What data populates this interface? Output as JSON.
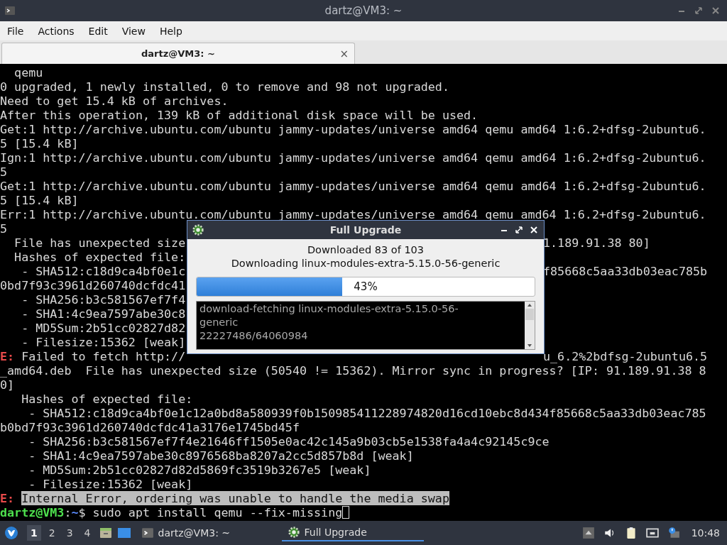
{
  "window": {
    "title": "dartz@VM3: ~",
    "menu": [
      "File",
      "Actions",
      "Edit",
      "View",
      "Help"
    ],
    "tabs": [
      {
        "label": "dartz@VM3: ~",
        "selected": true,
        "close": "×"
      }
    ],
    "terminal": {
      "lines": [
        {
          "segments": [
            {
              "kind": "text",
              "text": "  qemu"
            }
          ]
        },
        {
          "segments": [
            {
              "kind": "text",
              "text": "0 upgraded, 1 newly installed, 0 to remove and 98 not upgraded."
            }
          ]
        },
        {
          "segments": [
            {
              "kind": "text",
              "text": "Need to get 15.4 kB of archives."
            }
          ]
        },
        {
          "segments": [
            {
              "kind": "text",
              "text": "After this operation, 139 kB of additional disk space will be used."
            }
          ]
        },
        {
          "segments": [
            {
              "kind": "text",
              "text": "Get:1 http://archive.ubuntu.com/ubuntu jammy-updates/universe amd64 qemu amd64 1:6.2+dfsg-2ubuntu6."
            }
          ]
        },
        {
          "segments": [
            {
              "kind": "text",
              "text": "5 [15.4 kB]"
            }
          ]
        },
        {
          "segments": [
            {
              "kind": "text",
              "text": "Ign:1 http://archive.ubuntu.com/ubuntu jammy-updates/universe amd64 qemu amd64 1:6.2+dfsg-2ubuntu6."
            }
          ]
        },
        {
          "segments": [
            {
              "kind": "text",
              "text": "5"
            }
          ]
        },
        {
          "segments": [
            {
              "kind": "text",
              "text": "Get:1 http://archive.ubuntu.com/ubuntu jammy-updates/universe amd64 qemu amd64 1:6.2+dfsg-2ubuntu6."
            }
          ]
        },
        {
          "segments": [
            {
              "kind": "text",
              "text": "5 [15.4 kB]"
            }
          ]
        },
        {
          "segments": [
            {
              "kind": "text",
              "text": "Err:1 http://archive.ubuntu.com/ubuntu jammy-updates/universe amd64 qemu amd64 1:6.2+dfsg-2ubuntu6."
            }
          ]
        },
        {
          "segments": [
            {
              "kind": "text",
              "text": "5"
            }
          ]
        },
        {
          "segments": [
            {
              "kind": "text",
              "text": "  File has unexpected size"
            }
          ],
          "right": "1.189.91.38 80]"
        },
        {
          "segments": [
            {
              "kind": "text",
              "text": "  Hashes of expected file:"
            }
          ]
        },
        {
          "segments": [
            {
              "kind": "text",
              "text": "   - SHA512:c18d9ca4bf0e1c"
            }
          ],
          "right": "f85668c5aa33db03eac785b"
        },
        {
          "segments": [
            {
              "kind": "text",
              "text": "0bd7f93c3961d260740dcfdc41"
            }
          ]
        },
        {
          "segments": [
            {
              "kind": "text",
              "text": "   - SHA256:b3c581567ef7f4"
            }
          ]
        },
        {
          "segments": [
            {
              "kind": "text",
              "text": "   - SHA1:4c9ea7597abe30c8"
            }
          ]
        },
        {
          "segments": [
            {
              "kind": "text",
              "text": "   - MD5Sum:2b51cc02827d82"
            }
          ]
        },
        {
          "segments": [
            {
              "kind": "text",
              "text": "   - Filesize:15362 [weak]"
            }
          ]
        },
        {
          "segments": [
            {
              "kind": "error",
              "text": "E:"
            },
            {
              "kind": "text",
              "text": " Failed to fetch http://"
            }
          ],
          "right": "u_6.2%2bdfsg-2ubuntu6.5"
        },
        {
          "segments": [
            {
              "kind": "text",
              "text": "_amd64.deb  File has unexpected size (50540 != 15362). Mirror sync in progress? [IP: 91.189.91.38 8"
            }
          ]
        },
        {
          "segments": [
            {
              "kind": "text",
              "text": "0]"
            }
          ]
        },
        {
          "segments": [
            {
              "kind": "text",
              "text": "   Hashes of expected file:"
            }
          ]
        },
        {
          "segments": [
            {
              "kind": "text",
              "text": "    - SHA512:c18d9ca4bf0e1c12a0bd8a580939f0b150985411228974820d16cd10ebc8d434f85668c5aa33db03eac785"
            }
          ]
        },
        {
          "segments": [
            {
              "kind": "text",
              "text": "b0bd7f93c3961d260740dcfdc41a3176e1745bd45f"
            }
          ]
        },
        {
          "segments": [
            {
              "kind": "text",
              "text": "    - SHA256:b3c581567ef7f4e21646ff1505e0ac42c145a9b03cb5e1538fa4a4c92145c9ce"
            }
          ]
        },
        {
          "segments": [
            {
              "kind": "text",
              "text": "    - SHA1:4c9ea7597abe30c8976568ba8207a2cc5d857b8d [weak]"
            }
          ]
        },
        {
          "segments": [
            {
              "kind": "text",
              "text": "    - MD5Sum:2b51cc02827d82d5869fc3519b3267e5 [weak]"
            }
          ]
        },
        {
          "segments": [
            {
              "kind": "text",
              "text": "    - Filesize:15362 [weak]"
            }
          ]
        },
        {
          "segments": [
            {
              "kind": "error",
              "text": "E: "
            },
            {
              "kind": "selected",
              "text": "Internal Error, ordering was unable to handle the media swap"
            }
          ]
        },
        {
          "segments": [
            {
              "kind": "user",
              "text": "dartz@VM3"
            },
            {
              "kind": "text",
              "text": ":"
            },
            {
              "kind": "path",
              "text": "~"
            },
            {
              "kind": "text",
              "text": "$ sudo apt install qemu --fix-missing"
            }
          ],
          "cursor": true
        }
      ]
    }
  },
  "dialog": {
    "title": "Full Upgrade",
    "status": [
      "Downloaded 83 of 103",
      "Downloading linux-modules-extra-5.15.0-56-generic"
    ],
    "progress": {
      "level": 0.43,
      "reading": "43%"
    },
    "log": [
      "download-fetching linux-modules-extra-5.15.0-56-",
      "generic",
      "22227486/64060984"
    ]
  },
  "taskbar": {
    "workspaces": [
      {
        "label": "1",
        "selected": true
      },
      {
        "label": "2",
        "selected": false
      },
      {
        "label": "3",
        "selected": false
      },
      {
        "label": "4",
        "selected": false
      }
    ],
    "tasks": [
      {
        "kind": "terminal",
        "label": "dartz@VM3: ~",
        "selected": false
      },
      {
        "kind": "upgrade",
        "label": "Full Upgrade",
        "selected": true
      }
    ],
    "clock": "10:48"
  }
}
